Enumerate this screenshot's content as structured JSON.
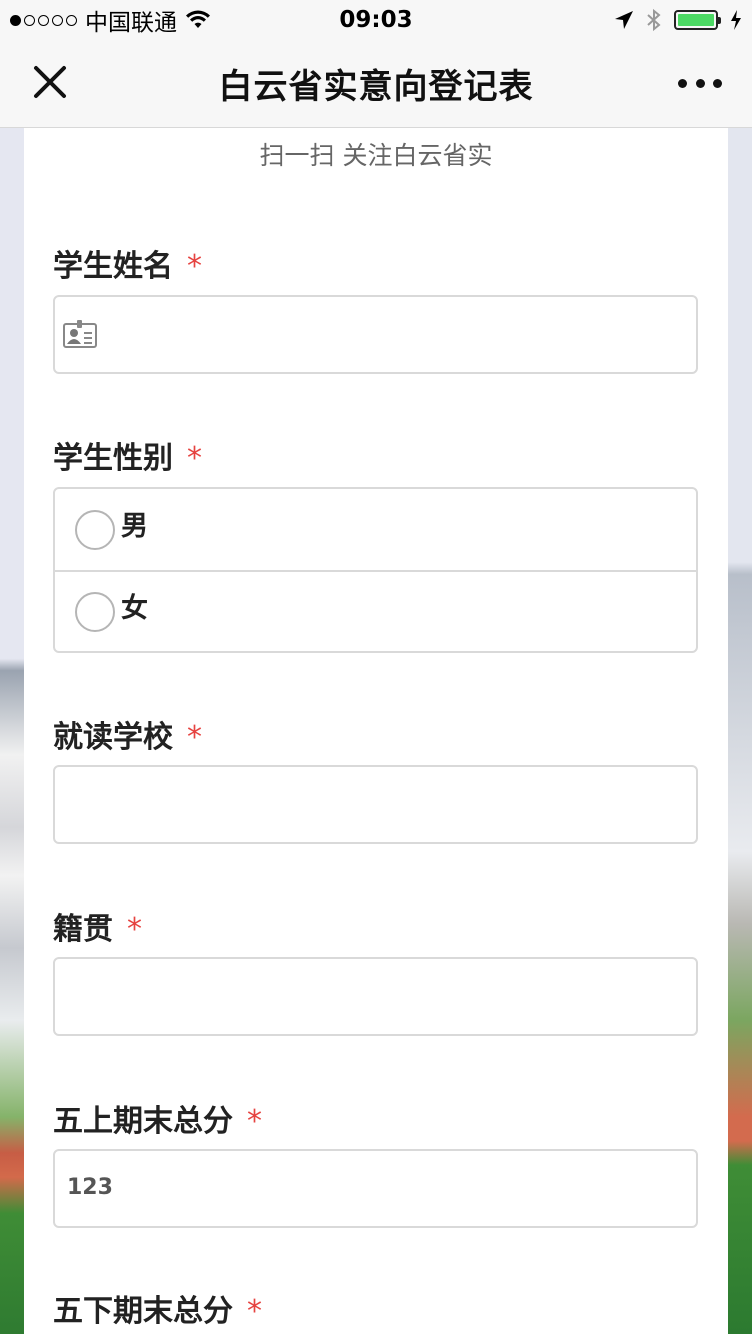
{
  "status_bar": {
    "carrier": "中国联通",
    "time": "09:03"
  },
  "nav": {
    "title": "白云省实意向登记表"
  },
  "form": {
    "subtitle": "扫一扫 关注白云省实",
    "required_mark": "*",
    "fields": [
      {
        "label": "学生姓名",
        "icon": "id-card-icon",
        "placeholder": ""
      },
      {
        "label": "学生性别",
        "options": [
          "男",
          "女"
        ]
      },
      {
        "label": "就读学校",
        "placeholder": ""
      },
      {
        "label": "籍贯",
        "placeholder": ""
      },
      {
        "label": "五上期末总分",
        "icon": "number-keypad-icon",
        "icon_text": "123",
        "placeholder": ""
      },
      {
        "label": "五下期末总分"
      }
    ]
  },
  "colors": {
    "required": "#e64340",
    "battery": "#4cd964",
    "border": "#d9d9d9"
  }
}
